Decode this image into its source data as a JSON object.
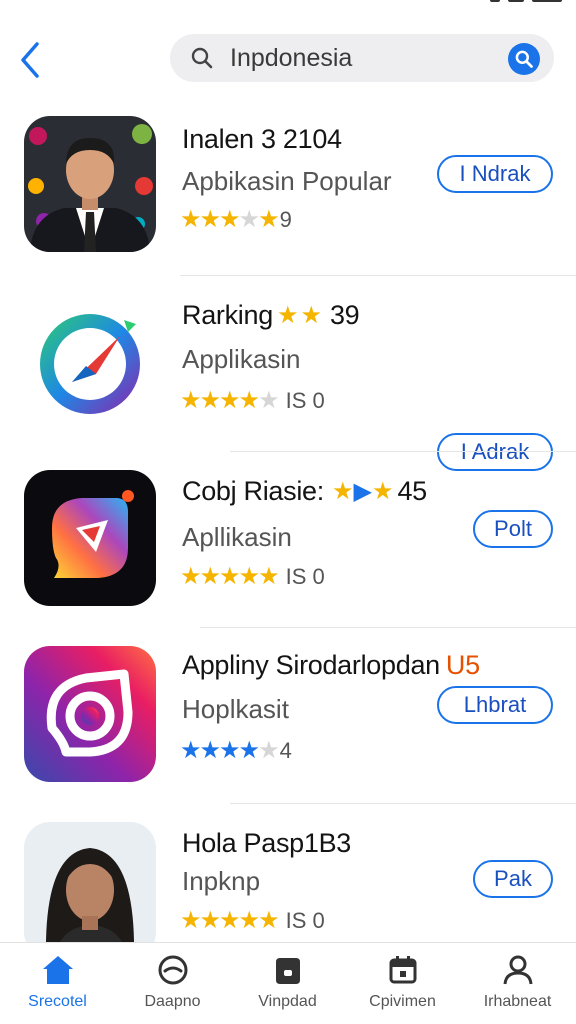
{
  "search": {
    "value": "Inpdonesia"
  },
  "apps": [
    {
      "title": "Inalen  3 2104",
      "subtitle": "Apbikasin Popular",
      "rating_text": "9",
      "stars": [
        "gold",
        "gold",
        "gold",
        "gray",
        "gold"
      ],
      "button_label": "I Ndrak",
      "icon": "person-portrait-icon"
    },
    {
      "title": "Rarking",
      "title_suffix": "39",
      "subtitle": "Applikasin",
      "rating_text": "IS  0",
      "stars": [
        "gold",
        "gold",
        "gold",
        "gold",
        "gray"
      ],
      "button_label": "I Adrak",
      "icon": "compass-icon"
    },
    {
      "title": "Cobj Riasie:",
      "title_suffix": "45",
      "subtitle": "Apllikasin",
      "rating_text": "IS  0",
      "stars": [
        "gold",
        "gold",
        "gold",
        "gold",
        "gold"
      ],
      "button_label": "Polt",
      "icon": "chat-bubble-icon"
    },
    {
      "title": "Appliny Sirodarlopdan",
      "title_suffix": "U5",
      "subtitle": "Hoplkasit",
      "rating_text": "4",
      "stars": [
        "blue",
        "blue",
        "blue",
        "blue",
        "gray"
      ],
      "button_label": "Lhbrat",
      "icon": "instagram-style-icon"
    },
    {
      "title": "Hola Pasp1B3",
      "subtitle": "Inpknp",
      "rating_text": "IS  0",
      "stars": [
        "gold",
        "gold",
        "gold",
        "gold",
        "gold"
      ],
      "button_label": "Pak",
      "icon": "woman-portrait-icon"
    }
  ],
  "nav": [
    {
      "label": "Srecotel",
      "icon": "home-icon",
      "active": true
    },
    {
      "label": "Daapno",
      "icon": "emoji-icon",
      "active": false
    },
    {
      "label": "Vinpdad",
      "icon": "download-icon",
      "active": false
    },
    {
      "label": "Cpivimen",
      "icon": "calendar-icon",
      "active": false
    },
    {
      "label": "Irhabneat",
      "icon": "profile-icon",
      "active": false
    }
  ],
  "colors": {
    "accent": "#1a73e8",
    "star_gold": "#f4b400",
    "star_gray": "#d6d6d6"
  }
}
